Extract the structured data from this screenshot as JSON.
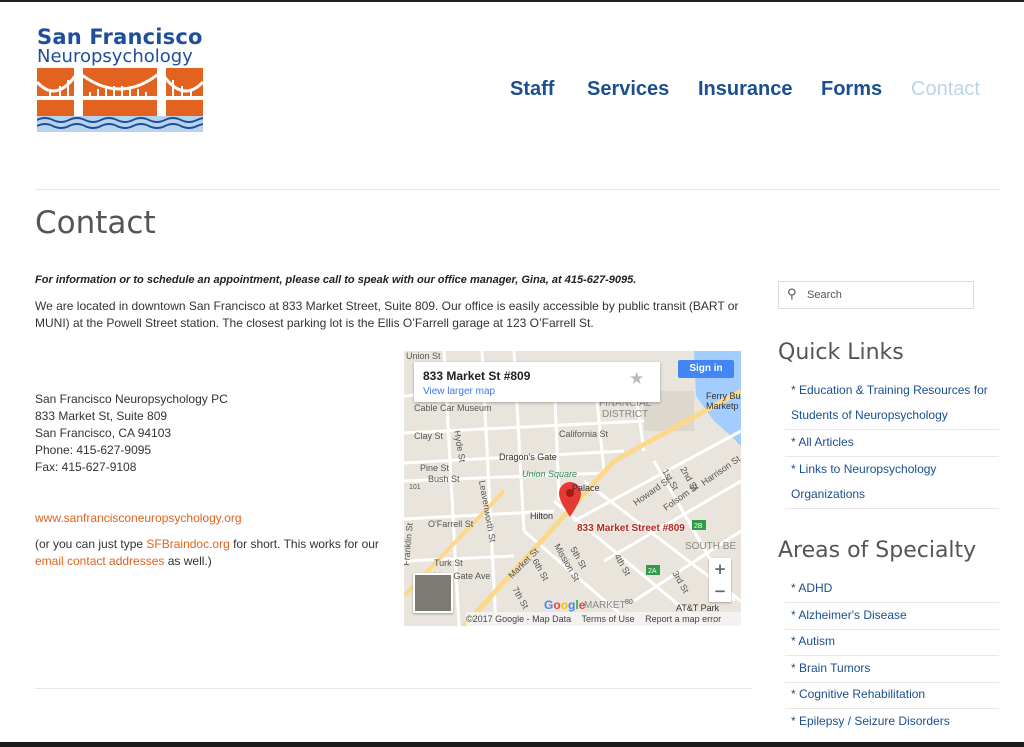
{
  "logo": {
    "line1": "San Francisco",
    "line2": "Neuropsychology",
    "colors": {
      "blue": "#1f4f9a",
      "orange": "#e2621f",
      "water": "#b9d3ef"
    }
  },
  "nav": {
    "items": [
      "Staff",
      "Services",
      "Insurance",
      "Forms",
      "Contact"
    ],
    "active": "Contact"
  },
  "page": {
    "title": "Contact",
    "intro": "For information or to schedule an appointment, please call to speak with our office manager, Gina, at 415-627-9095.",
    "location": "We are located in downtown San Francisco at 833 Market Street, Suite 809. Our office is easily accessible by public transit (BART or MUNI) at the Powell Street station. The closest parking lot is the Ellis O’Farrell garage at 123 O’Farrell St."
  },
  "address": {
    "name": "San Francisco Neuropsychology PC",
    "street": "833 Market St, Suite 809",
    "city": "San Francisco, CA 94103",
    "phone": "Phone: 415-627-9095",
    "fax": "Fax: 415-627-9108"
  },
  "website": "www.sanfrancisconeuropsychology.org",
  "shortnote": {
    "before": "(or you can just type ",
    "short_link": "SFBraindoc.org",
    "middle": " for short. This works for our ",
    "email_link": "email contact addresses",
    "after": " as well.)"
  },
  "map": {
    "card_title": "833 Market St #809",
    "card_link": "View larger map",
    "star_icon": "star-icon",
    "signin": "Sign in",
    "pin_label": "833 Market Street #809",
    "zoom_in": "+",
    "zoom_out": "−",
    "footer": [
      "©2017 Google - Map Data",
      "Terms of Use",
      "Report a map error"
    ],
    "google_logo": "Google",
    "labels": [
      "Union St",
      "Cable Car Museum",
      "FINANCIAL",
      "DISTRICT",
      "Ferry Bu",
      "Marketp",
      "Clay St",
      "California St",
      "Hyde St",
      "Dragon's Gate",
      "Union Square",
      "Pine St",
      "Bush St",
      "Palace",
      "Leavenworth St",
      "Hilton",
      "O'Farrell St",
      "Howard St",
      "Folsom St",
      "Harrison St",
      "1st St",
      "2nd St",
      "SOUTH BE",
      "Franklin St",
      "Turk St",
      "olden Gate Ave",
      "Market St",
      "6th St",
      "Mission St",
      "5th St",
      "4th St",
      "3rd St",
      "7th St",
      "MARKET",
      "AT&T Park",
      "101",
      "80",
      "2A",
      "2B"
    ]
  },
  "sidebar": {
    "search_placeholder": "Search",
    "quick_links_title": "Quick Links",
    "quick_links": [
      "* Education & Training Resources for Students of Neuropsychology",
      "* All Articles",
      "* Links to Neuropsychology Organizations"
    ],
    "specialty_title": "Areas of Specialty",
    "specialties": [
      "* ADHD",
      "* Alzheimer's Disease",
      "* Autism",
      "* Brain Tumors",
      "* Cognitive Rehabilitation",
      "* Epilepsy / Seizure Disorders"
    ]
  }
}
